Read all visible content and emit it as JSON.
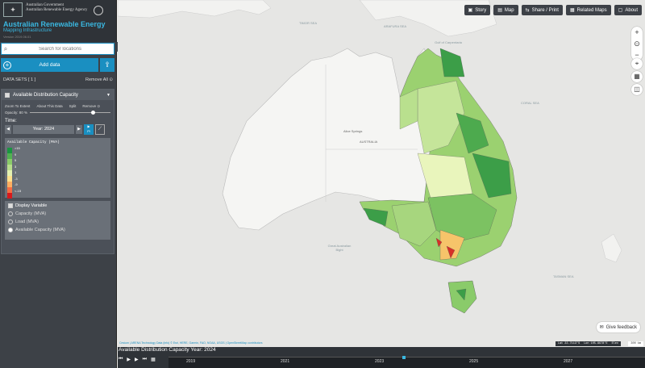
{
  "brand": {
    "gov_line1": "Australian Government",
    "gov_line2": "Australian Renewable Energy Agency",
    "title": "Australian Renewable Energy",
    "subtitle": "Mapping Infrastructure",
    "version": "Version 2019.06.01"
  },
  "search": {
    "placeholder": "Search for locations"
  },
  "add_data": {
    "label": "Add data"
  },
  "datasets": {
    "header": "DATA SETS",
    "count": "[ 1 ]",
    "remove_all": "Remove All",
    "item": {
      "title": "Available Distribution Capacity",
      "actions": [
        "Zoom To Extent",
        "About This Data",
        "Split",
        "Remove"
      ],
      "opacity_label": "Opacity: 80 %",
      "opacity_value": 0.8,
      "time_label": "Time:",
      "year_label": "Year: 2024",
      "legend": {
        "title": "Available Capacity (MVA)",
        "labels": [
          ">15",
          "9",
          "5",
          "3",
          "1",
          "-3",
          "-9",
          "<-15"
        ],
        "colors": [
          "#1a9641",
          "#52b151",
          "#8acb6a",
          "#b8de8c",
          "#e4f1b0",
          "#fee08b",
          "#fdae61",
          "#f46d43",
          "#d7191c"
        ]
      },
      "display_variable": {
        "title": "Display Variable",
        "options": [
          "Capacity (MVA)",
          "Load (MVA)",
          "Available Capacity (MVA)"
        ],
        "selected_index": 2
      }
    }
  },
  "toolbar": {
    "story": "Story",
    "map": "Map",
    "share": "Share / Print",
    "related": "Related Maps",
    "about": "About"
  },
  "map_labels": {
    "timor_sea": "TIMOR SEA",
    "gulf_carpentaria": "Gulf of Carpentaria",
    "arafura": "ARAFURA SEA",
    "coral_sea": "CORAL SEA",
    "alice_springs": "Alice Springs",
    "australia": "AUSTRALIA",
    "bight": "Great Australian Bight",
    "tasman": "TASMAN SEA"
  },
  "feedback": "Give feedback",
  "attribution": "Cesium | ARENA Technology Data (info) © Esri, HERE, Garmin, FAO, NOAA, USGS | OpenStreetMap contributors",
  "coords": {
    "lat": "Lat 22.7113°S",
    "lon": "Lon 105.9978°E",
    "elev": "Elev"
  },
  "scale": "300 km",
  "timeline": {
    "title": "Available Distribution Capacity Year: 2024",
    "years": [
      "2019",
      "2021",
      "2023",
      "2025",
      "2027"
    ],
    "current_fraction": 0.49
  }
}
